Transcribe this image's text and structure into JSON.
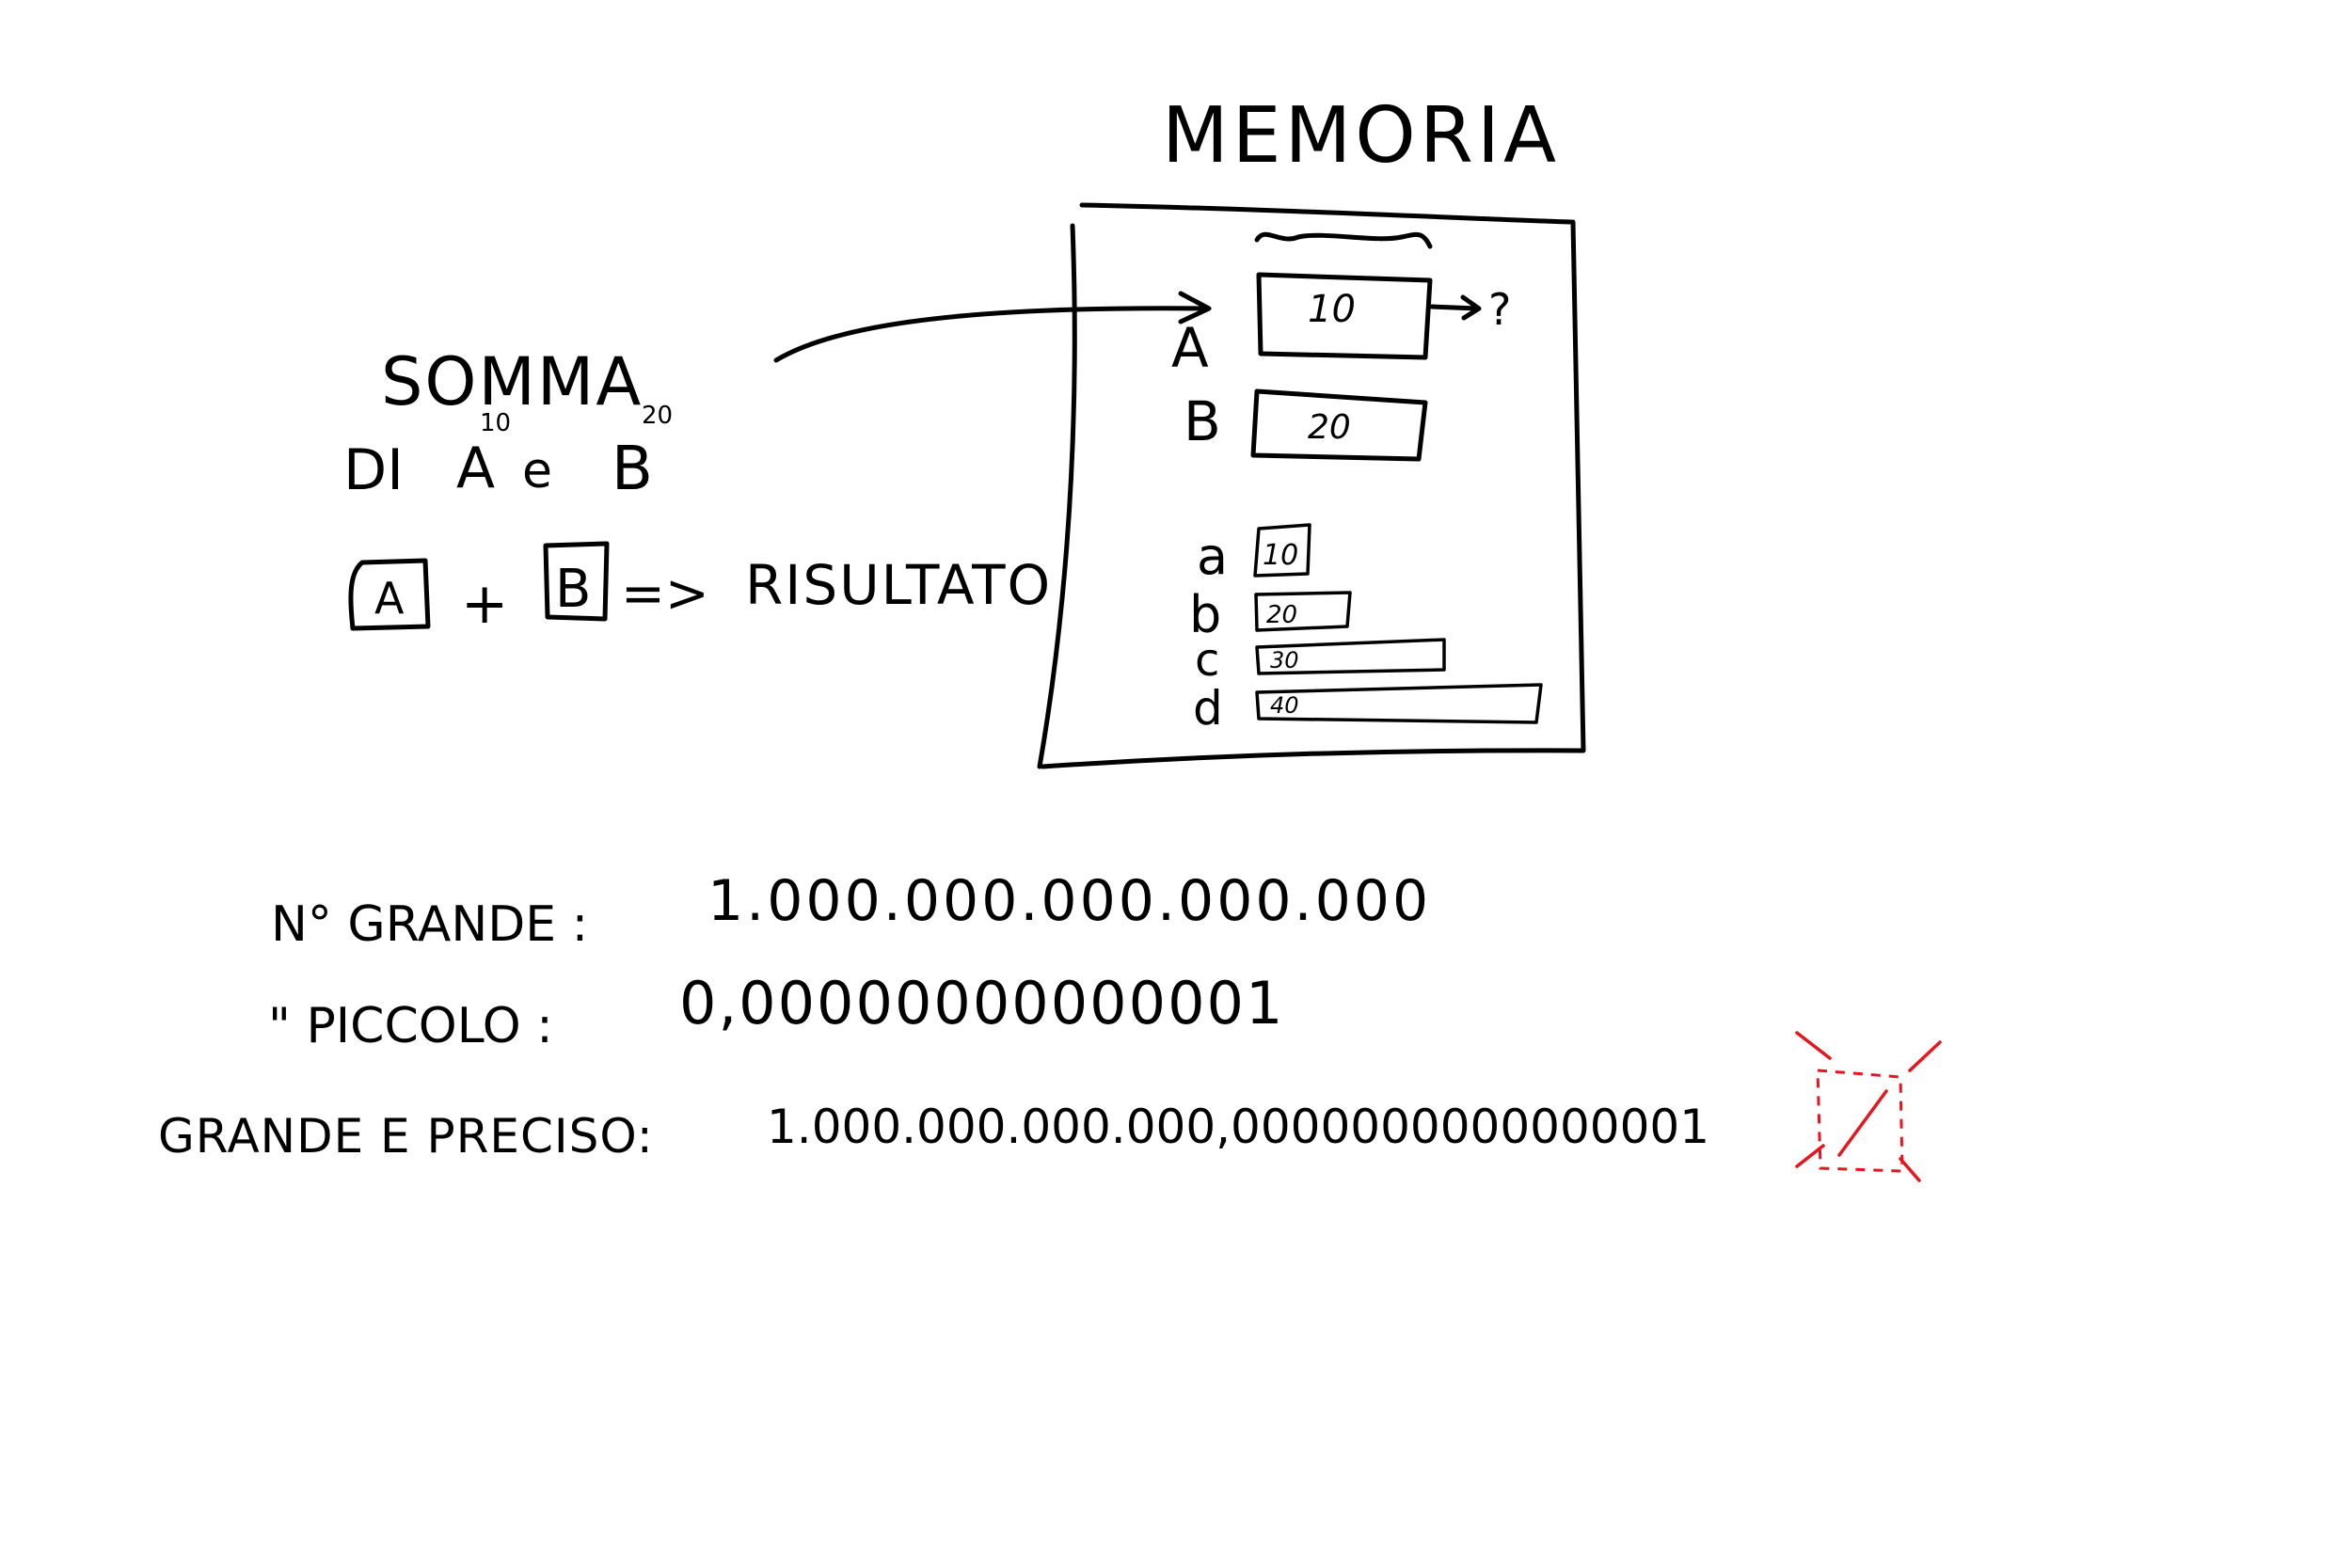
{
  "memory": {
    "title": "MEMORIA",
    "cell_a": {
      "label": "A",
      "value": "10",
      "arrow_target": "?"
    },
    "cell_b": {
      "label": "B",
      "value": "20"
    },
    "small_cells": [
      {
        "label": "a",
        "value": "10"
      },
      {
        "label": "b",
        "value": "20"
      },
      {
        "label": "c",
        "value": "30"
      },
      {
        "label": "d",
        "value": "40"
      }
    ]
  },
  "sum": {
    "title": "SOMMA",
    "line2_prefix": "DI",
    "var_a": "A",
    "var_a_sup": "10",
    "conj": "e",
    "var_b": "B",
    "var_b_sup": "20",
    "expr_a": "A",
    "plus": "+",
    "expr_b": "B",
    "arrow": "=>",
    "result": "RISULTATO"
  },
  "numbers": {
    "big_label": "N° GRANDE :",
    "big_value": "1.000.000.000.000.000",
    "small_label": "\" PICCOLO :",
    "small_value": "0,00000000000001",
    "precise_label": "GRANDE E PRECISO:",
    "precise_value": "1.000.000.000.000,0000000000000001"
  },
  "colors": {
    "ink": "#000000",
    "correction": "#e8141e",
    "background": "#ffffff"
  }
}
